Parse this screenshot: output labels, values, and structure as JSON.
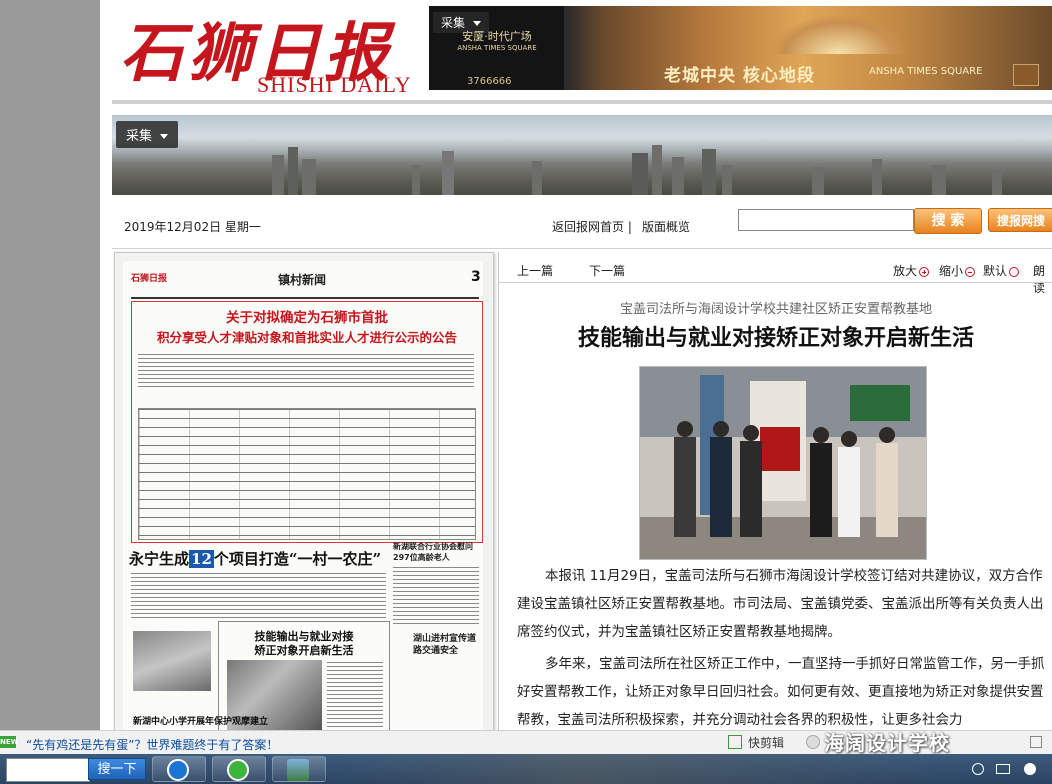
{
  "masthead": {
    "logo_cn": "石狮日报",
    "logo_en": "SHISHI DAILY",
    "collect_label": "采集",
    "ad": {
      "brand_cn": "安厦·时代广场",
      "brand_en": "ANSHA TIMES SQUARE",
      "phone": "3766666",
      "slogan": "老城中央  核心地段",
      "slogan_en": "ANSHA TIMES SQUARE"
    }
  },
  "banner": {
    "collect_label": "采集"
  },
  "datebar": {
    "date": "2019年12月02日  星期一",
    "home_link": "返回报网首页 |",
    "overview_link": "版面概览",
    "search_value": "",
    "search_button": "搜 索",
    "search_web_button": "搜报网搜"
  },
  "paper": {
    "logo": "石狮日报",
    "section": "镇村新闻",
    "page_number": "3",
    "headline": "关于对拟确定为石狮市首批积分享受人才津贴对象和首批实业人才进行公示的公告",
    "headline_line1": "关于对拟确定为石狮市首批",
    "headline_line2": "积分享受人才津贴对象和首批实业人才进行公示的公告",
    "sub_title_pre": "永宁",
    "sub_title_bold": "生成",
    "sub_title_num": "12",
    "sub_title_post": "个项目打造“一村一农庄”",
    "side_title": "新湖联合行业协会慰问297位高龄老人",
    "article_box_title_1": "技能输出与就业对接",
    "article_box_title_2": "矫正对象开启新生活",
    "bottom_title": "新湖中心小学开展年保护观摩建立",
    "right_bottom": "湖山进村宣传道路交通安全"
  },
  "article": {
    "prev": "上一篇",
    "next": "下一篇",
    "zoom_in": "放大",
    "zoom_out": "缩小",
    "default": "默认",
    "read": "朗读",
    "subtitle": "宝盖司法所与海阔设计学校共建社区矫正安置帮教基地",
    "title": "技能输出与就业对接矫正对象开启新生活",
    "para1": "本报讯 11月29日，宝盖司法所与石狮市海阔设计学校签订结对共建协议，双方合作建设宝盖镇社区矫正安置帮教基地。市司法局、宝盖镇党委、宝盖派出所等有关负责人出席签约仪式，并为宝盖镇社区矫正安置帮教基地揭牌。",
    "para2": "多年来，宝盖司法所在社区矫正工作中，一直坚持一手抓好日常监管工作，另一手抓好安置帮教工作，让矫正对象早日回归社会。如何更有效、更直接地为矫正对象提供安置帮教，宝盖司法所积极探索，并充分调动社会各界的积极性，让更多社会力"
  },
  "statusbar": {
    "news_badge": "NEW",
    "news_text": "“先有鸡还是先有蛋”？世界难题终于有了答案！",
    "kuaijian": "快剪辑",
    "watermark": "海阔设计学校"
  },
  "taskbar": {
    "search_button": "搜一下"
  },
  "colors": {
    "brand_red": "#c4161c",
    "button_orange": "#e8831f",
    "link_blue": "#0a4c9c"
  }
}
